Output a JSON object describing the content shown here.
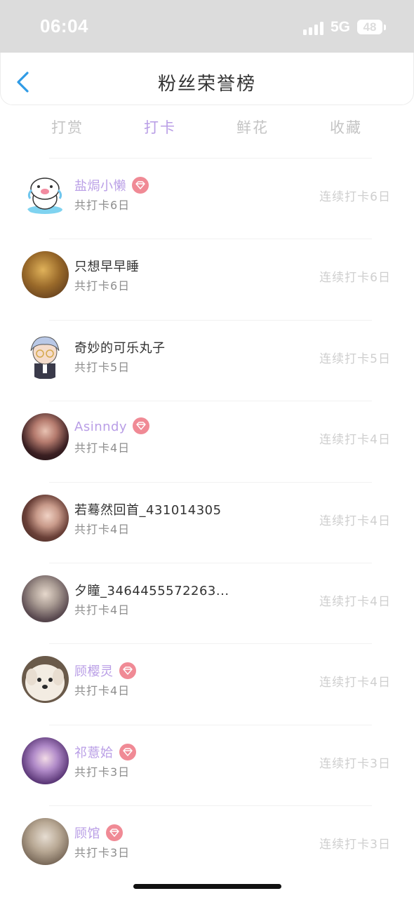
{
  "status_bar": {
    "time": "06:04",
    "network": "5G",
    "battery": "48"
  },
  "header": {
    "title": "粉丝荣誉榜"
  },
  "tabs": [
    {
      "label": "打赏",
      "active": false
    },
    {
      "label": "打卡",
      "active": true
    },
    {
      "label": "鲜花",
      "active": false
    },
    {
      "label": "收藏",
      "active": false
    }
  ],
  "colors": {
    "accent": "#b99ee6",
    "vip_badge": "#f08a95",
    "nav_back": "#2f9be6"
  },
  "fans": [
    {
      "name": "盐焗小懒",
      "vip": true,
      "total": "共打卡6日",
      "streak": "连续打卡6日",
      "avatar": "cartoon-cow-avatar"
    },
    {
      "name": "只想早早睡",
      "vip": false,
      "total": "共打卡6日",
      "streak": "连续打卡6日",
      "avatar": "photo-avatar"
    },
    {
      "name": "奇妙的可乐丸子",
      "vip": false,
      "total": "共打卡5日",
      "streak": "连续打卡5日",
      "avatar": "anime-boy-avatar"
    },
    {
      "name": "Asinndy",
      "vip": true,
      "total": "共打卡4日",
      "streak": "连续打卡4日",
      "avatar": "portrait-avatar"
    },
    {
      "name": "若蓦然回首_431014305",
      "vip": false,
      "total": "共打卡4日",
      "streak": "连续打卡4日",
      "avatar": "illustration-avatar"
    },
    {
      "name": "夕瞳_3464455572263...",
      "vip": false,
      "total": "共打卡4日",
      "streak": "连续打卡4日",
      "avatar": "anime-girl-avatar"
    },
    {
      "name": "顾樱灵",
      "vip": true,
      "total": "共打卡4日",
      "streak": "连续打卡4日",
      "avatar": "dog-avatar"
    },
    {
      "name": "祁薏姶",
      "vip": true,
      "total": "共打卡3日",
      "streak": "连续打卡3日",
      "avatar": "purple-girl-avatar"
    },
    {
      "name": "顾馆",
      "vip": true,
      "total": "共打卡3日",
      "streak": "连续打卡3日",
      "avatar": "sepia-avatar"
    }
  ]
}
